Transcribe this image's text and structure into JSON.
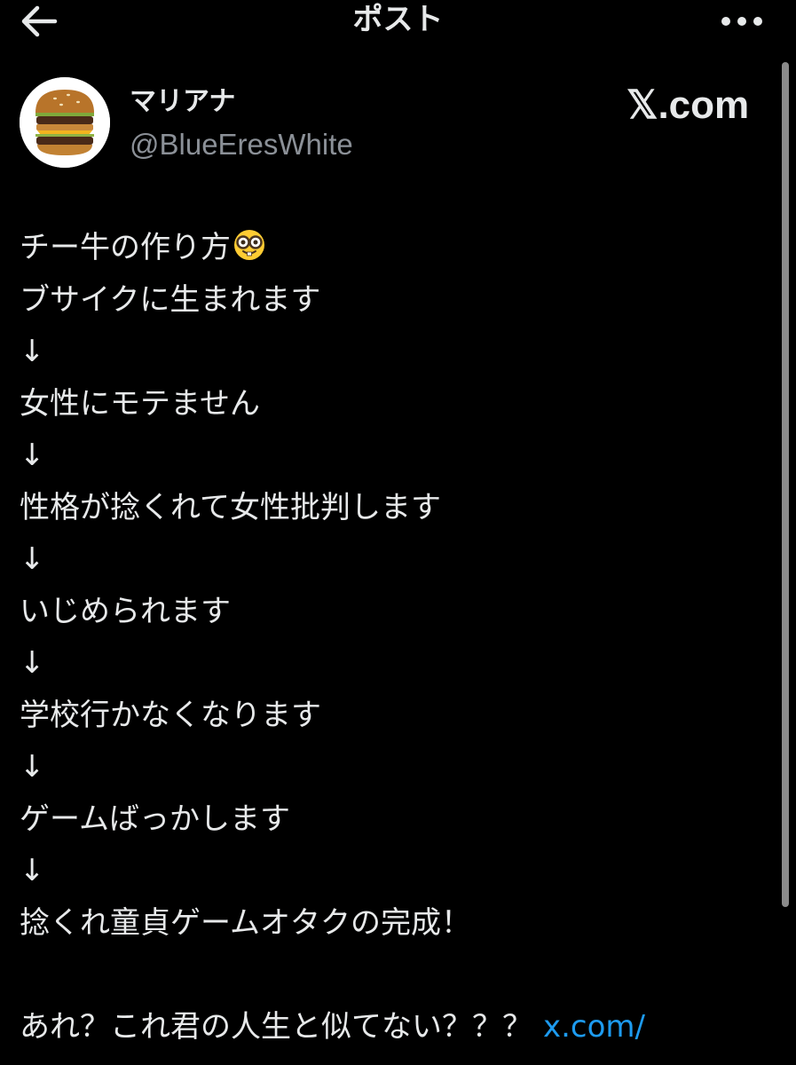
{
  "header": {
    "title": "ポスト",
    "back_icon": "arrow-left-icon",
    "more_icon": "more-horizontal-icon"
  },
  "author": {
    "display_name": "マリアナ",
    "handle": "@BlueEresWhite",
    "avatar_icon": "burger-avatar"
  },
  "source_badge": "𝕏.com",
  "post": {
    "lines": [
      "チー牛の作り方",
      "ブサイクに生まれます",
      "↓",
      "女性にモテません",
      "↓",
      "性格が捻くれて女性批判します",
      "↓",
      "いじめられます",
      "↓",
      "学校行かなくなります",
      "↓",
      "ゲームばっかします",
      "↓",
      "捻くれ童貞ゲームオタクの完成！",
      "",
      "あれ？これ君の人生と似てない？？？"
    ],
    "emoji_icon": "nerd-face-emoji",
    "link_text": "x.com/"
  },
  "colors": {
    "background": "#000000",
    "text": "#e7e9ea",
    "secondary_text": "#8b9097",
    "link": "#1d9bf0",
    "scrollbar": "#8b8b8b"
  }
}
